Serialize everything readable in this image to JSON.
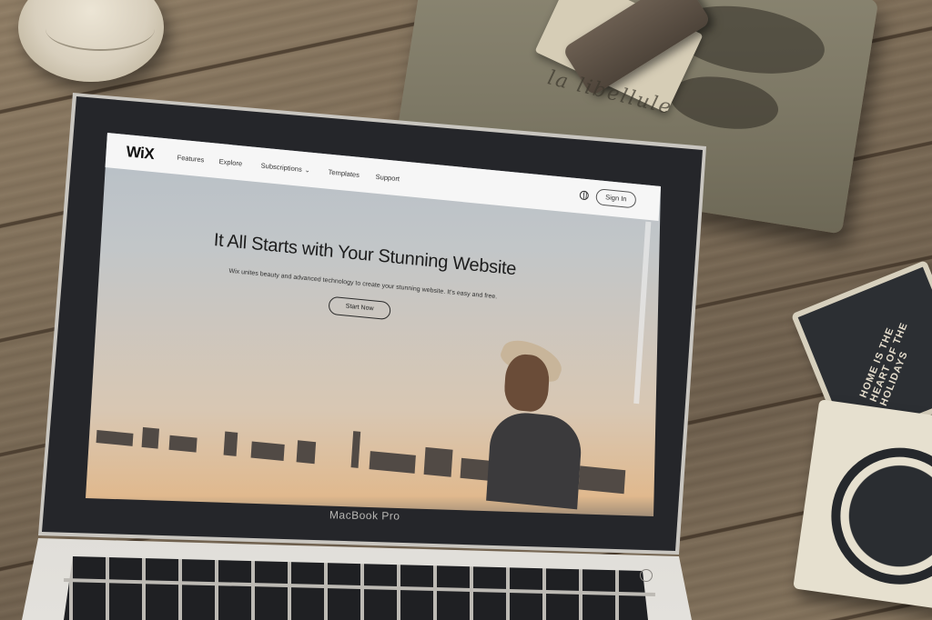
{
  "scene": {
    "pouch_text": "la libellule",
    "coaster_text": "HOME IS THE HEART OF THE HOLIDAYS",
    "laptop_brand": "MacBook Pro"
  },
  "site": {
    "logo": "WiX",
    "nav": [
      {
        "label": "Features"
      },
      {
        "label": "Explore"
      },
      {
        "label": "Subscriptions",
        "has_dropdown": true
      },
      {
        "label": "Templates"
      },
      {
        "label": "Support"
      }
    ],
    "globe_icon": "globe-icon",
    "signin_label": "Sign In",
    "hero": {
      "title": "It All Starts with Your Stunning Website",
      "subtitle": "Wix unites beauty and advanced technology to create your stunning website. It's easy and free.",
      "cta_label": "Start Now"
    }
  },
  "colors": {
    "navbar": "#f6f6f6",
    "sky_top": "#a9b6c5",
    "sunset": "#e0b98e",
    "water": "#3f5b74"
  }
}
